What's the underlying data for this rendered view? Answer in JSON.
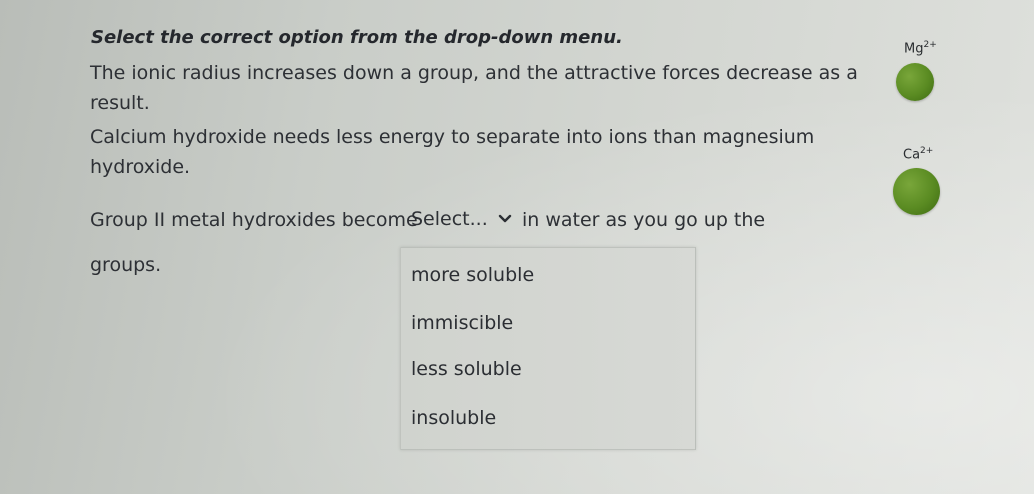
{
  "question": {
    "instructions": "Select the correct option from the drop-down menu.",
    "paragraph1_line1": "The ionic radius increases down a group, and the attractive forces decrease as a",
    "paragraph1_line2": "result.",
    "paragraph2_line1": "Calcium hydroxide needs less energy to separate into ions than magnesium",
    "paragraph2_line2": "hydroxide.",
    "sentence_before": "Group II metal hydroxides become",
    "sentence_after": "in water as you go up the",
    "sentence_end": "groups."
  },
  "dropdown": {
    "placeholder": "Select...",
    "options": [
      "more soluble",
      "immiscible",
      "less soluble",
      "insoluble"
    ]
  },
  "diagram": {
    "mg_symbol": "Mg",
    "mg_charge": "2+",
    "ca_symbol": "Ca",
    "ca_charge": "2+",
    "atom_color": "#5a8b22"
  }
}
